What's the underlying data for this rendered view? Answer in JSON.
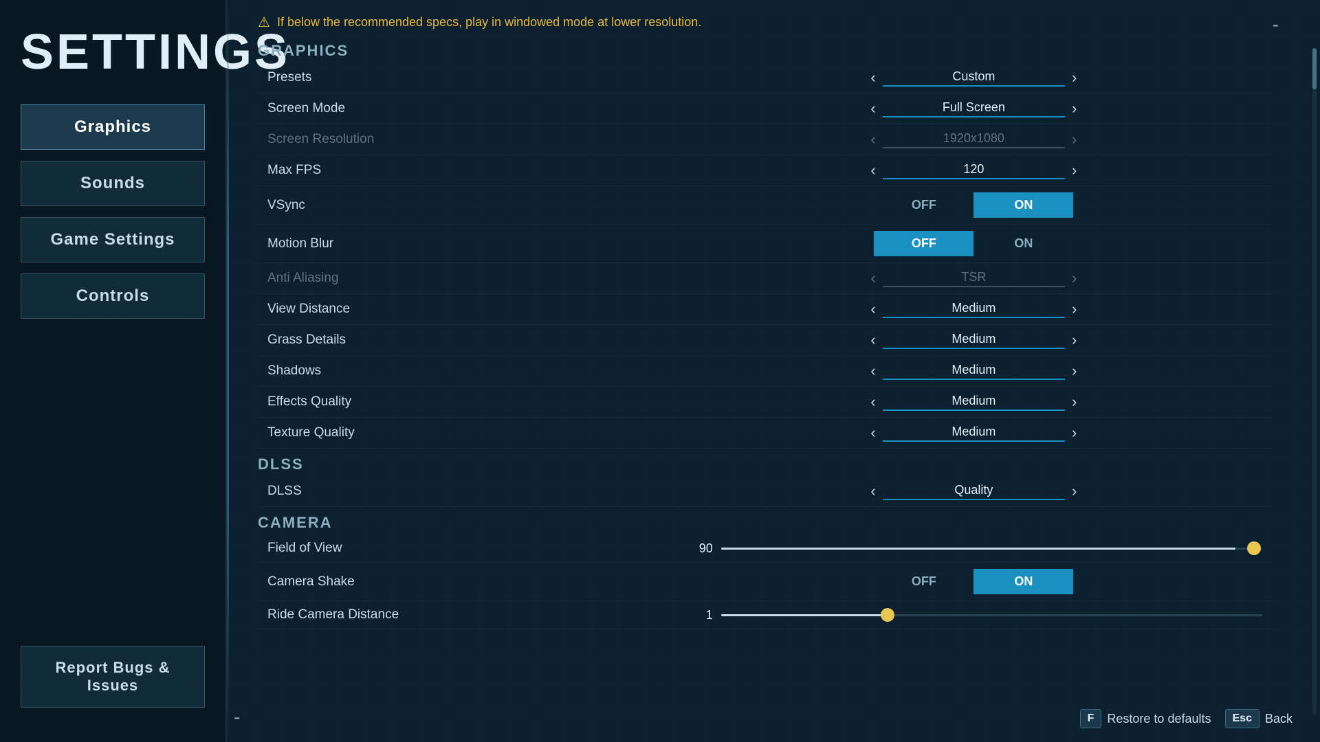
{
  "title": "SETTINGS",
  "title_dash": "-",
  "sidebar": {
    "nav_items": [
      {
        "id": "graphics",
        "label": "Graphics",
        "active": true
      },
      {
        "id": "sounds",
        "label": "Sounds",
        "active": false
      },
      {
        "id": "game-settings",
        "label": "Game Settings",
        "active": false
      },
      {
        "id": "controls",
        "label": "Controls",
        "active": false
      }
    ],
    "report_btn": "Report Bugs & Issues"
  },
  "warning": {
    "text": "If below the recommended specs, play in windowed mode at lower resolution."
  },
  "sections": {
    "graphics": {
      "heading": "Graphics",
      "rows": [
        {
          "id": "presets",
          "label": "Presets",
          "type": "arrow",
          "value": "Custom",
          "disabled": false
        },
        {
          "id": "screen-mode",
          "label": "Screen Mode",
          "type": "arrow",
          "value": "Full Screen",
          "disabled": false
        },
        {
          "id": "screen-resolution",
          "label": "Screen Resolution",
          "type": "arrow",
          "value": "1920x1080",
          "disabled": true
        },
        {
          "id": "max-fps",
          "label": "Max FPS",
          "type": "arrow",
          "value": "120",
          "disabled": false
        },
        {
          "id": "vsync",
          "label": "VSync",
          "type": "toggle",
          "off_label": "OFF",
          "on_label": "ON",
          "active": "on"
        },
        {
          "id": "motion-blur",
          "label": "Motion Blur",
          "type": "toggle",
          "off_label": "OFF",
          "on_label": "ON",
          "active": "off"
        },
        {
          "id": "anti-aliasing",
          "label": "Anti Aliasing",
          "type": "arrow",
          "value": "TSR",
          "disabled": true
        },
        {
          "id": "view-distance",
          "label": "View Distance",
          "type": "arrow",
          "value": "Medium",
          "disabled": false
        },
        {
          "id": "grass-details",
          "label": "Grass Details",
          "type": "arrow",
          "value": "Medium",
          "disabled": false
        },
        {
          "id": "shadows",
          "label": "Shadows",
          "type": "arrow",
          "value": "Medium",
          "disabled": false
        },
        {
          "id": "effects-quality",
          "label": "Effects Quality",
          "type": "arrow",
          "value": "Medium",
          "disabled": false
        },
        {
          "id": "texture-quality",
          "label": "Texture Quality",
          "type": "arrow",
          "value": "Medium",
          "disabled": false
        }
      ]
    },
    "dlss": {
      "heading": "DLSS",
      "rows": [
        {
          "id": "dlss",
          "label": "DLSS",
          "type": "arrow",
          "value": "Quality",
          "disabled": false
        }
      ]
    },
    "camera": {
      "heading": "Camera",
      "rows": [
        {
          "id": "fov",
          "label": "Field of View",
          "type": "slider",
          "value": "90",
          "fill_pct": 95
        },
        {
          "id": "camera-shake",
          "label": "Camera Shake",
          "type": "toggle",
          "off_label": "OFF",
          "on_label": "ON",
          "active": "on"
        },
        {
          "id": "ride-distance",
          "label": "Ride Camera Distance",
          "type": "slider",
          "value": "1",
          "fill_pct": 32
        }
      ]
    }
  },
  "bottom_bar": {
    "restore_key": "F",
    "restore_label": "Restore to defaults",
    "back_key": "Esc",
    "back_label": "Back"
  }
}
